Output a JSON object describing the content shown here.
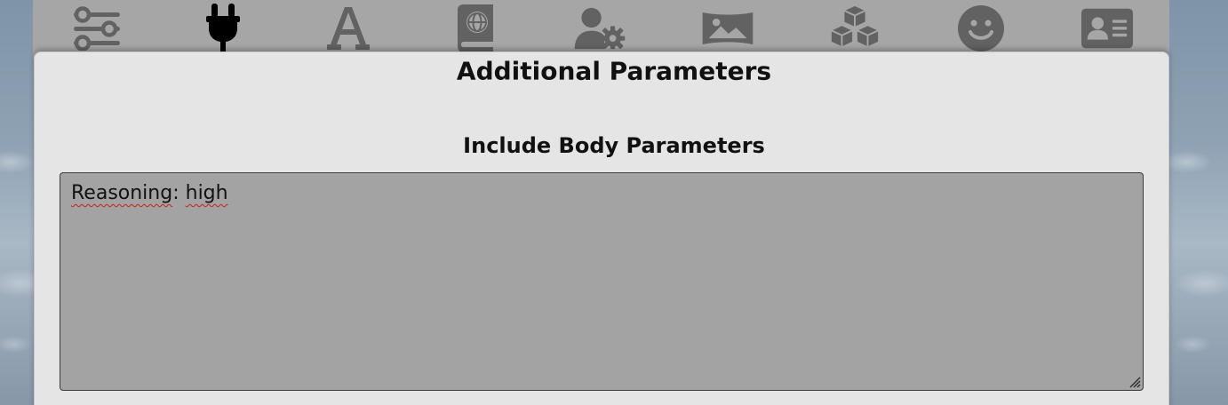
{
  "toolbar": {
    "items": [
      {
        "icon": "sliders-icon",
        "active": false
      },
      {
        "icon": "plug-icon",
        "active": true
      },
      {
        "icon": "font-icon",
        "active": false
      },
      {
        "icon": "world-book-icon",
        "active": false
      },
      {
        "icon": "user-gear-icon",
        "active": false
      },
      {
        "icon": "image-icon",
        "active": false
      },
      {
        "icon": "cubes-icon",
        "active": false
      },
      {
        "icon": "smiley-icon",
        "active": false
      },
      {
        "icon": "id-card-icon",
        "active": false
      }
    ],
    "icon_color": "#626262",
    "active_color": "#000000"
  },
  "panel": {
    "title": "Additional Parameters",
    "section_title": "Include Body Parameters",
    "textarea": {
      "word1": "Reasoning",
      "separator": ":",
      "word2": "high"
    }
  }
}
